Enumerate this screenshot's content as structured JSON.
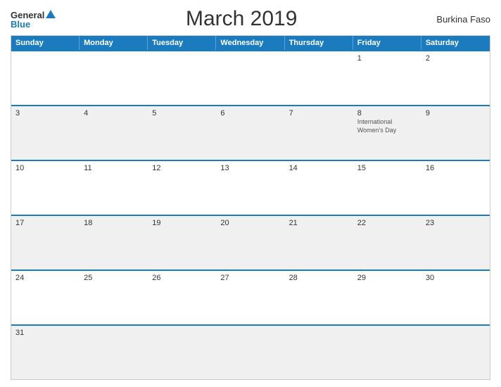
{
  "header": {
    "title": "March 2019",
    "country": "Burkina Faso",
    "logo": {
      "general": "General",
      "blue": "Blue"
    }
  },
  "calendar": {
    "days_of_week": [
      "Sunday",
      "Monday",
      "Tuesday",
      "Wednesday",
      "Thursday",
      "Friday",
      "Saturday"
    ],
    "weeks": [
      [
        {
          "day": "",
          "event": ""
        },
        {
          "day": "",
          "event": ""
        },
        {
          "day": "",
          "event": ""
        },
        {
          "day": "",
          "event": ""
        },
        {
          "day": "",
          "event": ""
        },
        {
          "day": "1",
          "event": ""
        },
        {
          "day": "2",
          "event": ""
        }
      ],
      [
        {
          "day": "3",
          "event": ""
        },
        {
          "day": "4",
          "event": ""
        },
        {
          "day": "5",
          "event": ""
        },
        {
          "day": "6",
          "event": ""
        },
        {
          "day": "7",
          "event": ""
        },
        {
          "day": "8",
          "event": "International Women's Day"
        },
        {
          "day": "9",
          "event": ""
        }
      ],
      [
        {
          "day": "10",
          "event": ""
        },
        {
          "day": "11",
          "event": ""
        },
        {
          "day": "12",
          "event": ""
        },
        {
          "day": "13",
          "event": ""
        },
        {
          "day": "14",
          "event": ""
        },
        {
          "day": "15",
          "event": ""
        },
        {
          "day": "16",
          "event": ""
        }
      ],
      [
        {
          "day": "17",
          "event": ""
        },
        {
          "day": "18",
          "event": ""
        },
        {
          "day": "19",
          "event": ""
        },
        {
          "day": "20",
          "event": ""
        },
        {
          "day": "21",
          "event": ""
        },
        {
          "day": "22",
          "event": ""
        },
        {
          "day": "23",
          "event": ""
        }
      ],
      [
        {
          "day": "24",
          "event": ""
        },
        {
          "day": "25",
          "event": ""
        },
        {
          "day": "26",
          "event": ""
        },
        {
          "day": "27",
          "event": ""
        },
        {
          "day": "28",
          "event": ""
        },
        {
          "day": "29",
          "event": ""
        },
        {
          "day": "30",
          "event": ""
        }
      ],
      [
        {
          "day": "31",
          "event": ""
        },
        {
          "day": "",
          "event": ""
        },
        {
          "day": "",
          "event": ""
        },
        {
          "day": "",
          "event": ""
        },
        {
          "day": "",
          "event": ""
        },
        {
          "day": "",
          "event": ""
        },
        {
          "day": "",
          "event": ""
        }
      ]
    ]
  }
}
